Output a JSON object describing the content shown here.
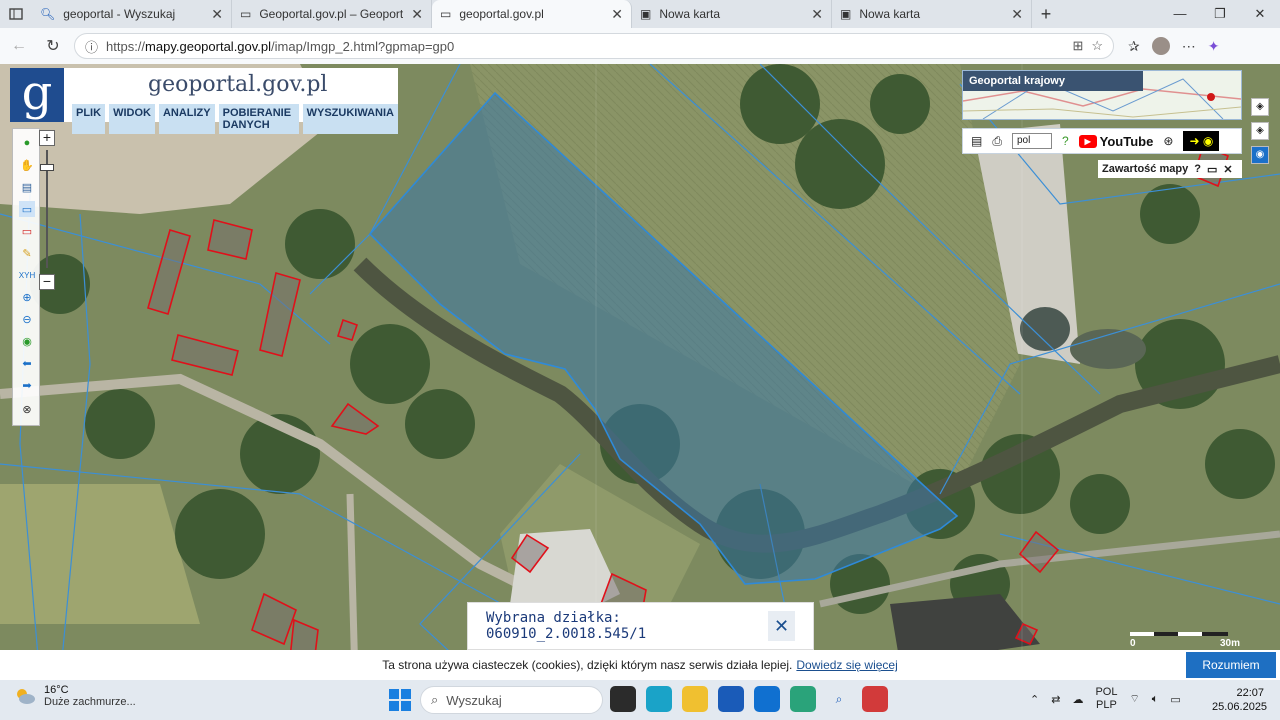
{
  "browser": {
    "tabs": [
      {
        "title": "geoportal - Wyszukaj",
        "icon": "search-icon"
      },
      {
        "title": "Geoportal.gov.pl – Geoportal Infrastruktury",
        "icon": "document-icon"
      },
      {
        "title": "geoportal.gov.pl",
        "icon": "document-icon",
        "active": true
      },
      {
        "title": "Nowa karta",
        "icon": "newtab-icon"
      },
      {
        "title": "Nowa karta",
        "icon": "newtab-icon"
      }
    ],
    "url_prefix": "https://",
    "url_host": "mapy.geoportal.gov.pl",
    "url_path": "/imap/Imgp_2.html?gpmap=gp0"
  },
  "geoportal": {
    "logo_letter": "g",
    "logo_text": "geoportal.gov.pl",
    "menu": [
      "PLIK",
      "WIDOK",
      "ANALIZY",
      "POBIERANIE DANYCH",
      "WYSZUKIWANIA"
    ],
    "overview_title": "Geoportal krajowy",
    "language": "pol",
    "youtube_label": "YouTube",
    "content_title": "Zawartość mapy",
    "scale_label": "30m",
    "scale_zero": "0",
    "selected_parcel": "Wybrana działka: 060910_2.0018.545/1"
  },
  "cookie": {
    "text": "Ta strona używa ciasteczek (cookies), dzięki którym nasz serwis działa lepiej.",
    "link": "Dowiedz się więcej",
    "button": "Rozumiem"
  },
  "taskbar": {
    "temperature": "16°C",
    "weather": "Duże zachmurze...",
    "search_placeholder": "Wyszukaj",
    "lang1": "POL",
    "lang2": "PLP",
    "time": "22:07",
    "date": "25.06.2025"
  }
}
